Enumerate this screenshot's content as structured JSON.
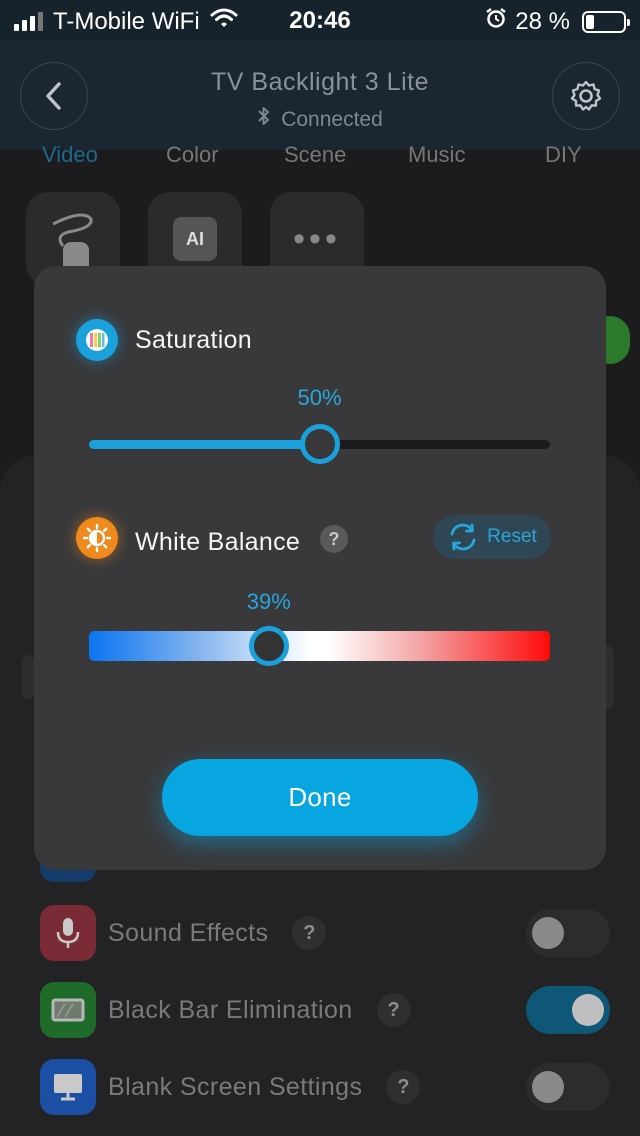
{
  "status_bar": {
    "carrier": "T-Mobile WiFi",
    "time": "20:46",
    "battery": "28 %"
  },
  "header": {
    "title": "TV Backlight 3 Lite",
    "connection_status": "Connected"
  },
  "mode_tabs": [
    "Video",
    "Color",
    "Scene",
    "Music",
    "DIY"
  ],
  "active_tab": "Video",
  "mode_tiles": {
    "ai_label": "AI",
    "more_label": "•••"
  },
  "settings": [
    {
      "label": "Sound Effects",
      "help": "?",
      "toggle_on": false,
      "color": "#7a2b36"
    },
    {
      "label": "Black Bar Elimination",
      "help": "?",
      "toggle_on": true,
      "color": "#1e6b2a"
    },
    {
      "label": "Blank Screen Settings",
      "help": "?",
      "toggle_on": false,
      "color": "#1b4fa3"
    }
  ],
  "modal": {
    "saturation": {
      "title": "Saturation",
      "value_label": "50%",
      "value": 50
    },
    "white_balance": {
      "title": "White Balance",
      "help": "?",
      "reset_label": "Reset",
      "value_label": "39%",
      "value": 39
    },
    "done_label": "Done"
  },
  "colors": {
    "accent": "#1aa0da",
    "done_button": "#08a6e1",
    "saturation_icon": "#1aa0da",
    "white_balance_icon": "#f08a1e",
    "modal_bg": "#39393b"
  }
}
